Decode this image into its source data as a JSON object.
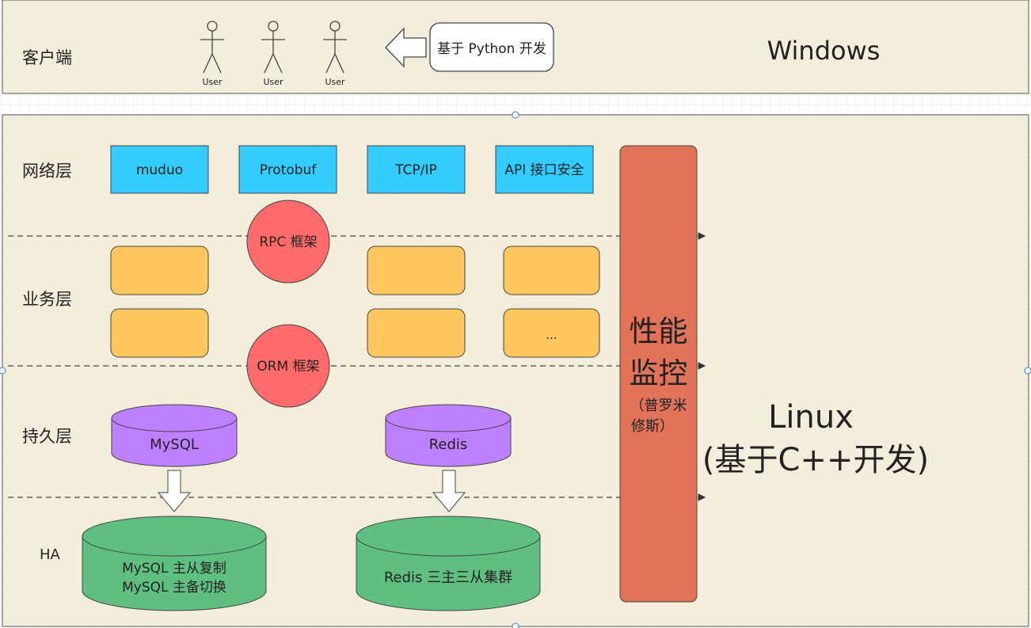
{
  "client": {
    "layer_label": "客户端",
    "os_label": "Windows",
    "users": [
      "User",
      "User",
      "User"
    ],
    "python_box": "基于 Python 开发"
  },
  "server": {
    "os_label_line1": "Linux",
    "os_label_line2": "(基于C++开发)",
    "layers": {
      "network": "网络层",
      "business": "业务层",
      "persistence": "持久层",
      "ha": "HA"
    },
    "network_boxes": [
      "muduo",
      "Protobuf",
      "TCP/IP",
      "API 接口安全"
    ],
    "rpc": "RPC 框架",
    "orm": "ORM 框架",
    "business_boxes": [
      "",
      "",
      "",
      "",
      "",
      "..."
    ],
    "db": {
      "mysql": "MySQL",
      "redis": "Redis",
      "mysql_ha_line1": "MySQL 主从复制",
      "mysql_ha_line2": "MySQL 主备切换",
      "redis_ha": "Redis 三主三从集群"
    },
    "monitor": {
      "title_line1": "性能",
      "title_line2": "监控",
      "sub_line1": "（普罗米",
      "sub_line2": "修斯）"
    }
  },
  "colors": {
    "panel_bg": "#f3eedc",
    "network_box": "#33ccff",
    "business_box": "#ffc75e",
    "framework_circle": "#ff6b6b",
    "db_purple": "#bf80ff",
    "db_green": "#5fbf80",
    "monitor": "#e07358"
  }
}
